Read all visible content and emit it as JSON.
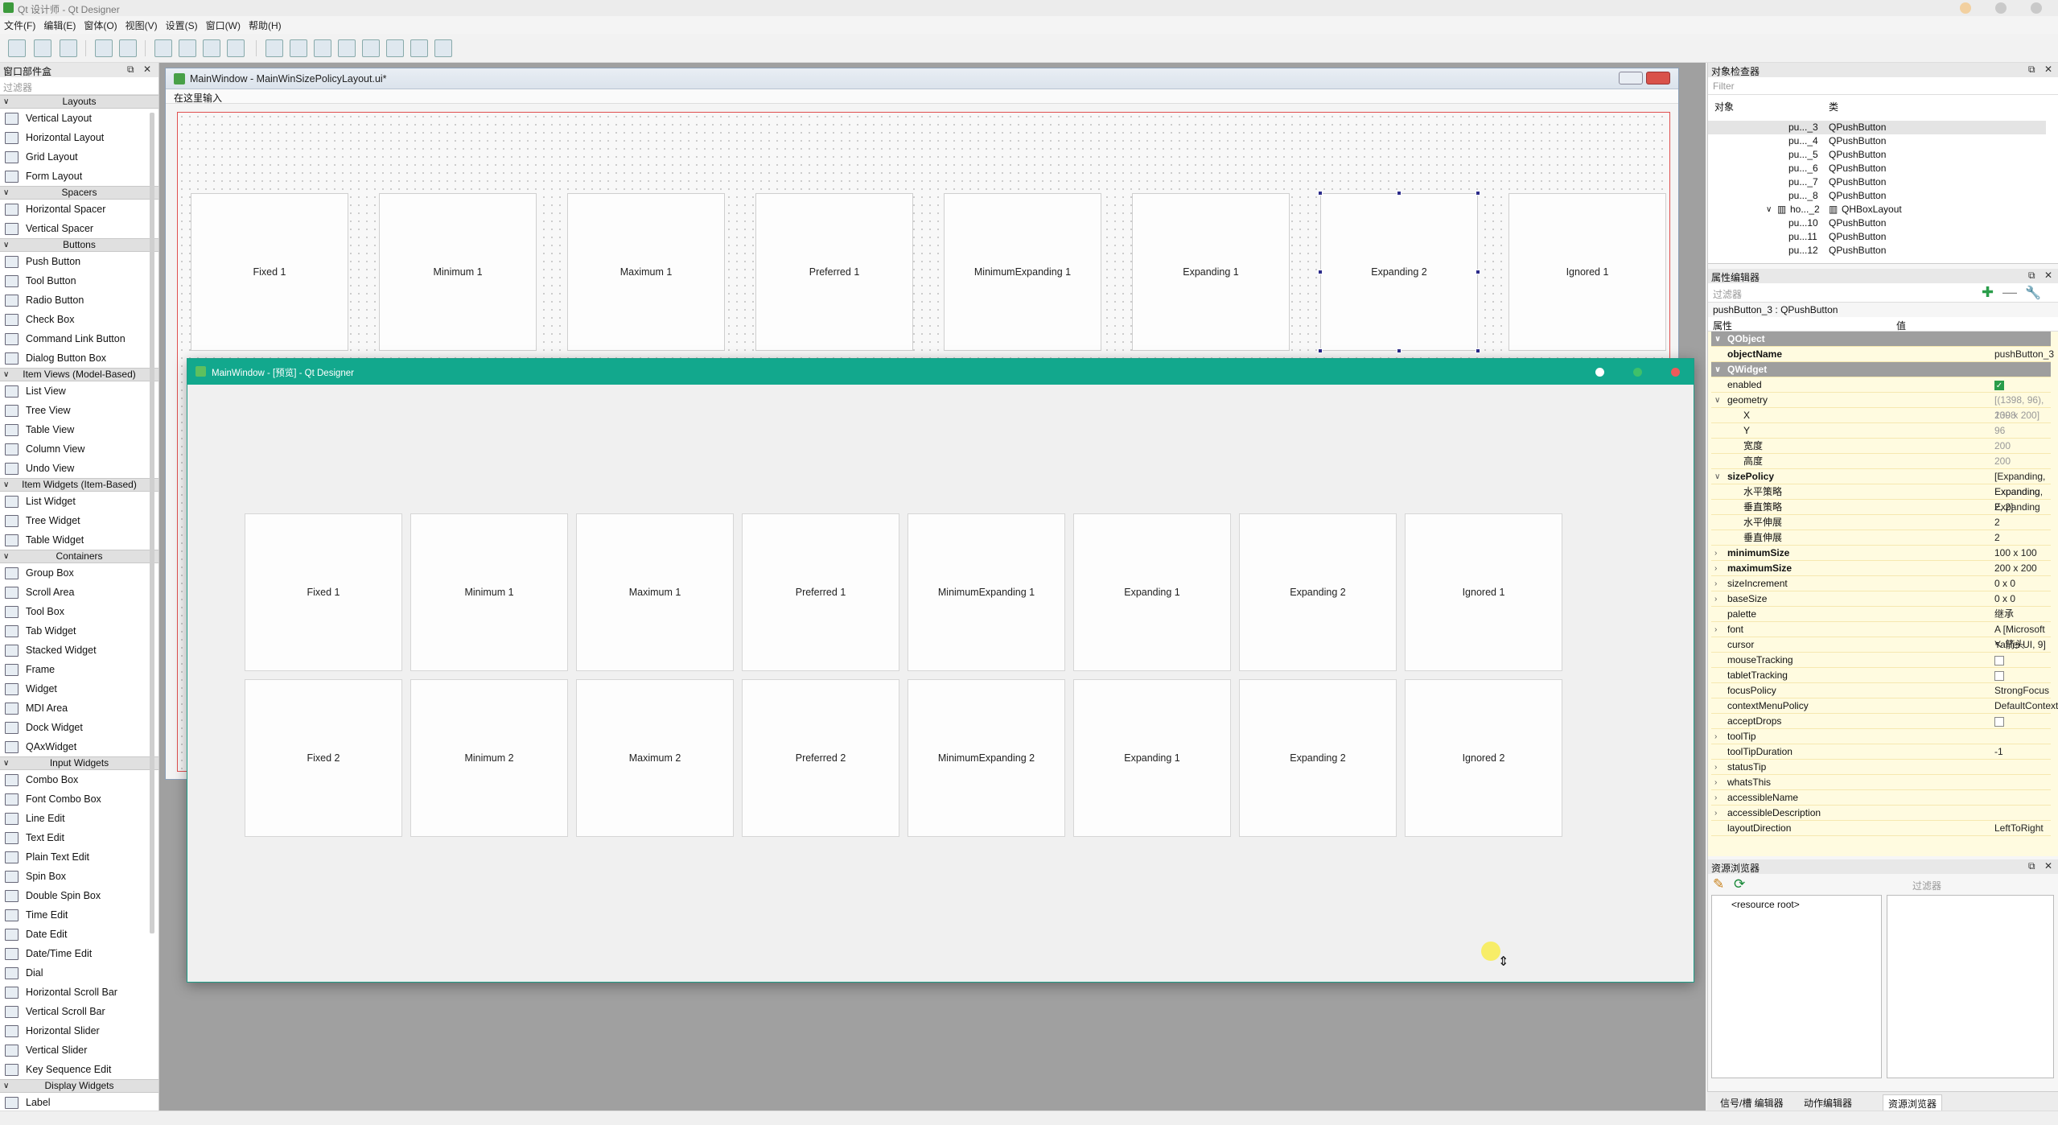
{
  "app": {
    "title": "Qt 设计师 - Qt Designer"
  },
  "menubar": [
    "文件(F)",
    "编辑(E)",
    "窗体(O)",
    "视图(V)",
    "设置(S)",
    "窗口(W)",
    "帮助(H)"
  ],
  "toolbar_icons": [
    "new-file-icon",
    "open-file-icon",
    "save-icon",
    "send-to-back-icon",
    "bring-to-front-icon",
    "edit-widgets-icon",
    "edit-signals-icon",
    "edit-buddies-icon",
    "edit-tab-order-icon",
    "layout-horizontal-icon",
    "layout-vertical-icon",
    "layout-h-splitter-icon",
    "layout-v-splitter-icon",
    "layout-grid-icon",
    "layout-form-icon",
    "break-layout-icon",
    "adjust-size-icon"
  ],
  "widgetbox": {
    "title": "窗口部件盒",
    "filter_placeholder": "过滤器",
    "sections": [
      {
        "name": "Layouts",
        "items": [
          "Vertical Layout",
          "Horizontal Layout",
          "Grid Layout",
          "Form Layout"
        ]
      },
      {
        "name": "Spacers",
        "items": [
          "Horizontal Spacer",
          "Vertical Spacer"
        ]
      },
      {
        "name": "Buttons",
        "items": [
          "Push Button",
          "Tool Button",
          "Radio Button",
          "Check Box",
          "Command Link Button",
          "Dialog Button Box"
        ]
      },
      {
        "name": "Item Views (Model-Based)",
        "items": [
          "List View",
          "Tree View",
          "Table View",
          "Column View",
          "Undo View"
        ]
      },
      {
        "name": "Item Widgets (Item-Based)",
        "items": [
          "List Widget",
          "Tree Widget",
          "Table Widget"
        ]
      },
      {
        "name": "Containers",
        "items": [
          "Group Box",
          "Scroll Area",
          "Tool Box",
          "Tab Widget",
          "Stacked Widget",
          "Frame",
          "Widget",
          "MDI Area",
          "Dock Widget",
          "QAxWidget"
        ]
      },
      {
        "name": "Input Widgets",
        "items": [
          "Combo Box",
          "Font Combo Box",
          "Line Edit",
          "Text Edit",
          "Plain Text Edit",
          "Spin Box",
          "Double Spin Box",
          "Time Edit",
          "Date Edit",
          "Date/Time Edit",
          "Dial",
          "Horizontal Scroll Bar",
          "Vertical Scroll Bar",
          "Horizontal Slider",
          "Vertical Slider",
          "Key Sequence Edit"
        ]
      },
      {
        "name": "Display Widgets",
        "items": [
          "Label"
        ]
      }
    ]
  },
  "form_window": {
    "title": "MainWindow - MainWinSizePolicyLayout.ui*",
    "menu_placeholder": "在这里输入",
    "buttons": [
      "Fixed 1",
      "Minimum 1",
      "Maximum 1",
      "Preferred 1",
      "MinimumExpanding 1",
      "Expanding 1",
      "Expanding 2",
      "Ignored 1"
    ]
  },
  "preview_window": {
    "title": "MainWindow - [预览] - Qt Designer",
    "row1": [
      "Fixed 1",
      "Minimum 1",
      "Maximum 1",
      "Preferred 1",
      "MinimumExpanding 1",
      "Expanding 1",
      "Expanding 2",
      "Ignored 1"
    ],
    "row2": [
      "Fixed 2",
      "Minimum 2",
      "Maximum 2",
      "Preferred 2",
      "MinimumExpanding 2",
      "Expanding 1",
      "Expanding 2",
      "Ignored 2"
    ]
  },
  "object_inspector": {
    "title": "对象检查器",
    "filter_placeholder": "Filter",
    "col_object": "对象",
    "col_class": "类",
    "rows": [
      {
        "object": "pu..._3",
        "class": "QPushButton",
        "selected": true
      },
      {
        "object": "pu..._4",
        "class": "QPushButton"
      },
      {
        "object": "pu..._5",
        "class": "QPushButton"
      },
      {
        "object": "pu..._6",
        "class": "QPushButton"
      },
      {
        "object": "pu..._7",
        "class": "QPushButton"
      },
      {
        "object": "pu..._8",
        "class": "QPushButton"
      },
      {
        "object": "ho..._2",
        "class": "QHBoxLayout"
      },
      {
        "object": "pu...10",
        "class": "QPushButton"
      },
      {
        "object": "pu...11",
        "class": "QPushButton"
      },
      {
        "object": "pu...12",
        "class": "QPushButton"
      }
    ]
  },
  "property_editor": {
    "title": "属性编辑器",
    "filter_placeholder": "过滤器",
    "subject": "pushButton_3 : QPushButton",
    "col_property": "属性",
    "col_value": "值",
    "rows": [
      {
        "type": "section",
        "name": "QObject"
      },
      {
        "name": "objectName",
        "value": "pushButton_3",
        "bold": true
      },
      {
        "type": "section",
        "name": "QWidget"
      },
      {
        "name": "enabled",
        "check": true
      },
      {
        "name": "geometry",
        "value": "[(1398, 96), 200 x 200]",
        "expand": "v",
        "dim": true
      },
      {
        "name": "X",
        "value": "1398",
        "sub": true,
        "dim": true
      },
      {
        "name": "Y",
        "value": "96",
        "sub": true,
        "dim": true
      },
      {
        "name": "宽度",
        "value": "200",
        "sub": true,
        "dim": true
      },
      {
        "name": "高度",
        "value": "200",
        "sub": true,
        "dim": true
      },
      {
        "name": "sizePolicy",
        "value": "[Expanding, Expanding, 2, 2]",
        "expand": "v",
        "bold": true
      },
      {
        "name": "水平策略",
        "value": "Expanding",
        "sub": true
      },
      {
        "name": "垂直策略",
        "value": "Expanding",
        "sub": true
      },
      {
        "name": "水平伸展",
        "value": "2",
        "sub": true
      },
      {
        "name": "垂直伸展",
        "value": "2",
        "sub": true
      },
      {
        "name": "minimumSize",
        "value": "100 x 100",
        "expand": ">",
        "bold": true
      },
      {
        "name": "maximumSize",
        "value": "200 x 200",
        "expand": ">",
        "bold": true
      },
      {
        "name": "sizeIncrement",
        "value": "0 x 0",
        "expand": ">"
      },
      {
        "name": "baseSize",
        "value": "0 x 0",
        "expand": ">"
      },
      {
        "name": "palette",
        "value": "继承"
      },
      {
        "name": "font",
        "value": "A  [Microsoft YaHei UI, 9]",
        "expand": ">"
      },
      {
        "name": "cursor",
        "value": "↖  箭头"
      },
      {
        "name": "mouseTracking",
        "check": false
      },
      {
        "name": "tabletTracking",
        "check": false
      },
      {
        "name": "focusPolicy",
        "value": "StrongFocus"
      },
      {
        "name": "contextMenuPolicy",
        "value": "DefaultContextMenu"
      },
      {
        "name": "acceptDrops",
        "check": false
      },
      {
        "name": "toolTip",
        "value": "",
        "expand": ">"
      },
      {
        "name": "toolTipDuration",
        "value": "-1"
      },
      {
        "name": "statusTip",
        "value": "",
        "expand": ">"
      },
      {
        "name": "whatsThis",
        "value": "",
        "expand": ">"
      },
      {
        "name": "accessibleName",
        "value": "",
        "expand": ">"
      },
      {
        "name": "accessibleDescription",
        "value": "",
        "expand": ">"
      },
      {
        "name": "layoutDirection",
        "value": "LeftToRight"
      }
    ]
  },
  "resource_browser": {
    "title": "资源浏览器",
    "filter_placeholder": "过滤器",
    "root": "<resource root>"
  },
  "bottom_tabs": [
    "信号/槽 编辑器",
    "动作编辑器",
    "资源浏览器"
  ],
  "colors": {
    "accent": "#12a88d",
    "selection_border": "#e05050",
    "section_bg": "#9e9e9e",
    "property_bg": "#fffbe0"
  }
}
